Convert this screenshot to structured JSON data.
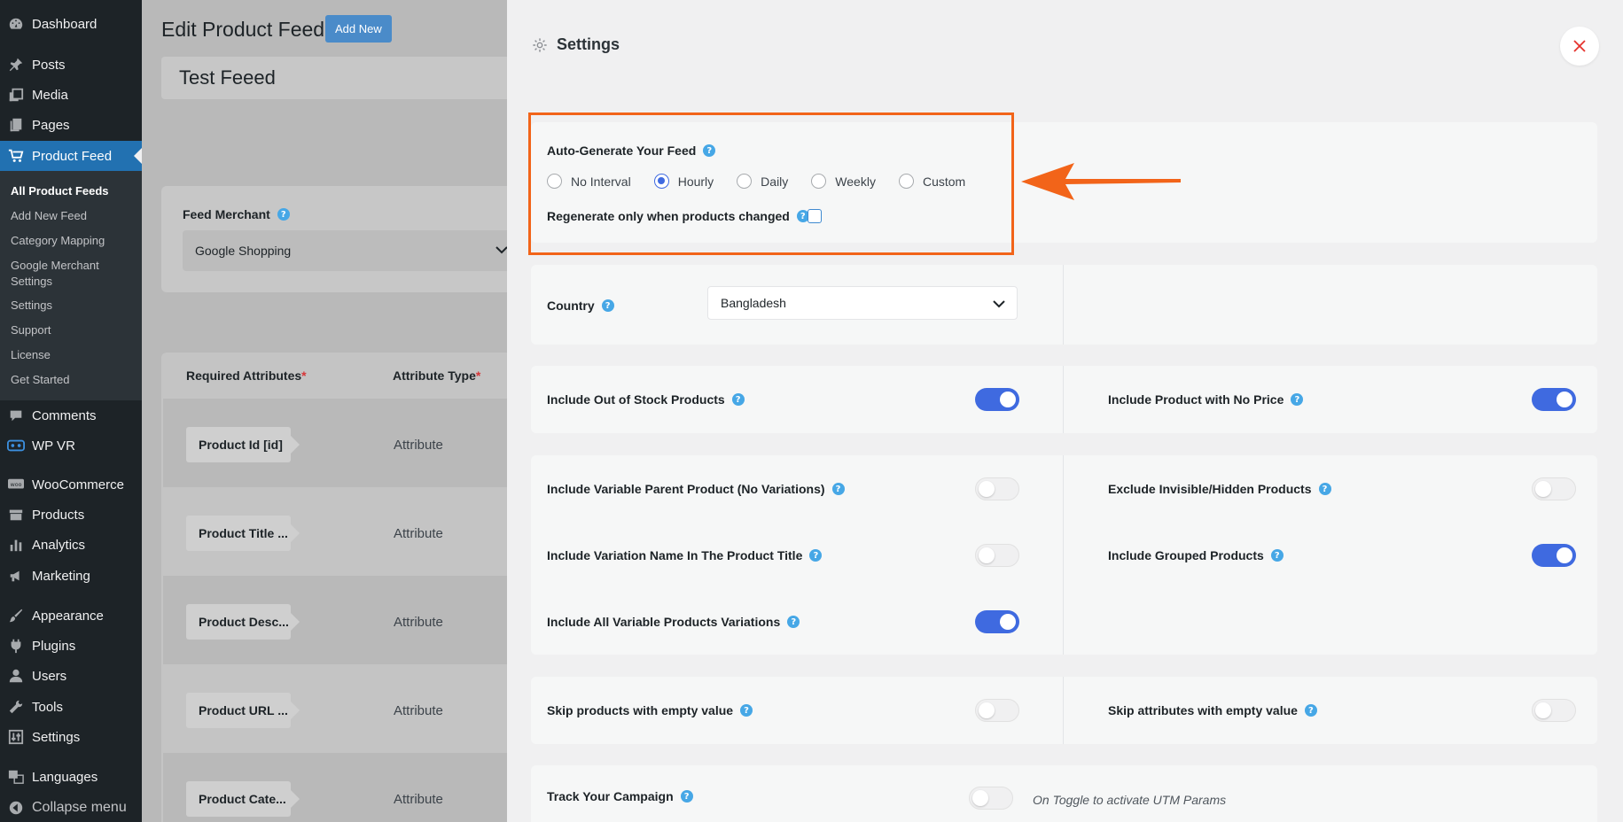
{
  "sidebar": {
    "items": [
      {
        "label": "Dashboard",
        "icon": "dashboard-icon"
      },
      {
        "label": "Posts",
        "icon": "pin-icon"
      },
      {
        "label": "Media",
        "icon": "media-icon"
      },
      {
        "label": "Pages",
        "icon": "pages-icon"
      },
      {
        "label": "Product Feed",
        "icon": "cart-icon"
      },
      {
        "label": "Comments",
        "icon": "comment-icon"
      },
      {
        "label": "WP VR",
        "icon": "vr-icon"
      },
      {
        "label": "WooCommerce",
        "icon": "woo-icon"
      },
      {
        "label": "Products",
        "icon": "archive-icon"
      },
      {
        "label": "Analytics",
        "icon": "bar-chart-icon"
      },
      {
        "label": "Marketing",
        "icon": "megaphone-icon"
      },
      {
        "label": "Appearance",
        "icon": "brush-icon"
      },
      {
        "label": "Plugins",
        "icon": "plug-icon"
      },
      {
        "label": "Users",
        "icon": "user-icon"
      },
      {
        "label": "Tools",
        "icon": "wrench-icon"
      },
      {
        "label": "Settings",
        "icon": "settings-icon"
      },
      {
        "label": "Languages",
        "icon": "translate-icon"
      },
      {
        "label": "Collapse menu",
        "icon": "collapse-icon"
      }
    ],
    "submenu": [
      "All Product Feeds",
      "Add New Feed",
      "Category Mapping",
      "Google Merchant Settings",
      "Settings",
      "Support",
      "License",
      "Get Started"
    ]
  },
  "page": {
    "title": "Edit Product Feed",
    "add_new": "Add New",
    "feed_name": "Test Feeed",
    "merchant_label": "Feed Merchant",
    "merchant_value": "Google Shopping",
    "required_attributes": "Required Attributes",
    "attribute_type": "Attribute Type",
    "star": "*",
    "rows": [
      {
        "name": "Product Id [id]",
        "type": "Attribute"
      },
      {
        "name": "Product Title ...",
        "type": "Attribute"
      },
      {
        "name": "Product Desc...",
        "type": "Attribute"
      },
      {
        "name": "Product URL ...",
        "type": "Attribute"
      },
      {
        "name": "Product Cate...",
        "type": "Attribute"
      }
    ]
  },
  "drawer": {
    "title": "Settings",
    "auto_generate": {
      "label": "Auto-Generate Your Feed",
      "options": [
        "No Interval",
        "Hourly",
        "Daily",
        "Weekly",
        "Custom"
      ],
      "selected": "Hourly",
      "regenerate_label": "Regenerate only when products changed"
    },
    "country": {
      "label": "Country",
      "value": "Bangladesh"
    },
    "toggles": {
      "out_of_stock": {
        "label": "Include Out of Stock Products",
        "on": true
      },
      "no_price": {
        "label": "Include Product with No Price",
        "on": true
      },
      "variable_parent": {
        "label": "Include Variable Parent Product (No Variations)",
        "on": false
      },
      "invisible": {
        "label": "Exclude Invisible/Hidden Products",
        "on": false
      },
      "variation_name": {
        "label": "Include Variation Name In The Product Title",
        "on": false
      },
      "grouped": {
        "label": "Include Grouped Products",
        "on": true
      },
      "all_variations": {
        "label": "Include All Variable Products Variations",
        "on": true
      },
      "skip_products": {
        "label": "Skip products with empty value",
        "on": false
      },
      "skip_attributes": {
        "label": "Skip attributes with empty value",
        "on": false
      },
      "track_campaign": {
        "label": "Track Your Campaign",
        "on": false
      }
    },
    "campaign_hint": "On Toggle to activate UTM Params"
  },
  "colors": {
    "accent": "#3f6ae0",
    "highlight": "#f26419",
    "wp_blue": "#2271b1",
    "help": "#46a7e6"
  }
}
